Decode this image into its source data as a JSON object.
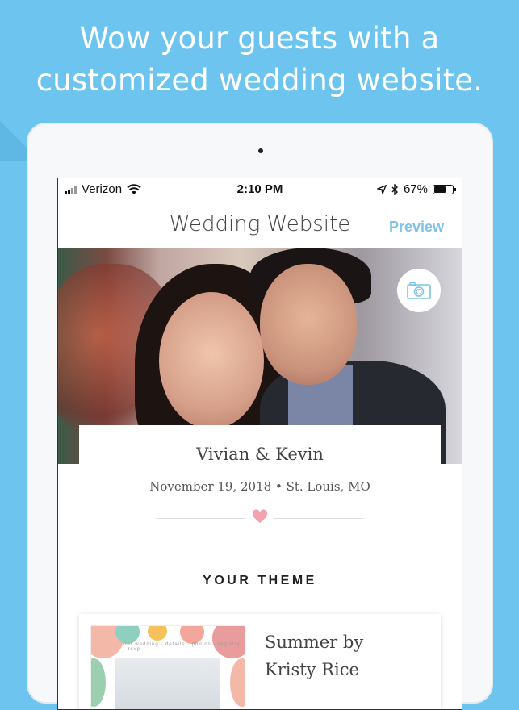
{
  "headline": {
    "line1": "Wow your guests with a",
    "line2": "customized wedding website."
  },
  "status_bar": {
    "carrier": "Verizon",
    "time": "2:10 PM",
    "battery": "67%",
    "battery_level": 0.67
  },
  "nav": {
    "title": "Wedding Website",
    "preview_label": "Preview"
  },
  "hero": {
    "camera_icon": "camera-icon"
  },
  "couple": {
    "names": "Vivian & Kevin",
    "details": "November 19, 2018 • St. Louis, MO"
  },
  "theme": {
    "section_title": "YOUR THEME",
    "name_line1": "Summer by",
    "name_line2": "Kristy Rice",
    "thumb_nav": "our wedding · details · photos · registry · rsvp"
  },
  "colors": {
    "background": "#6cc4ef",
    "accent": "#7cc3e6",
    "heart": "#f0a3ad"
  }
}
